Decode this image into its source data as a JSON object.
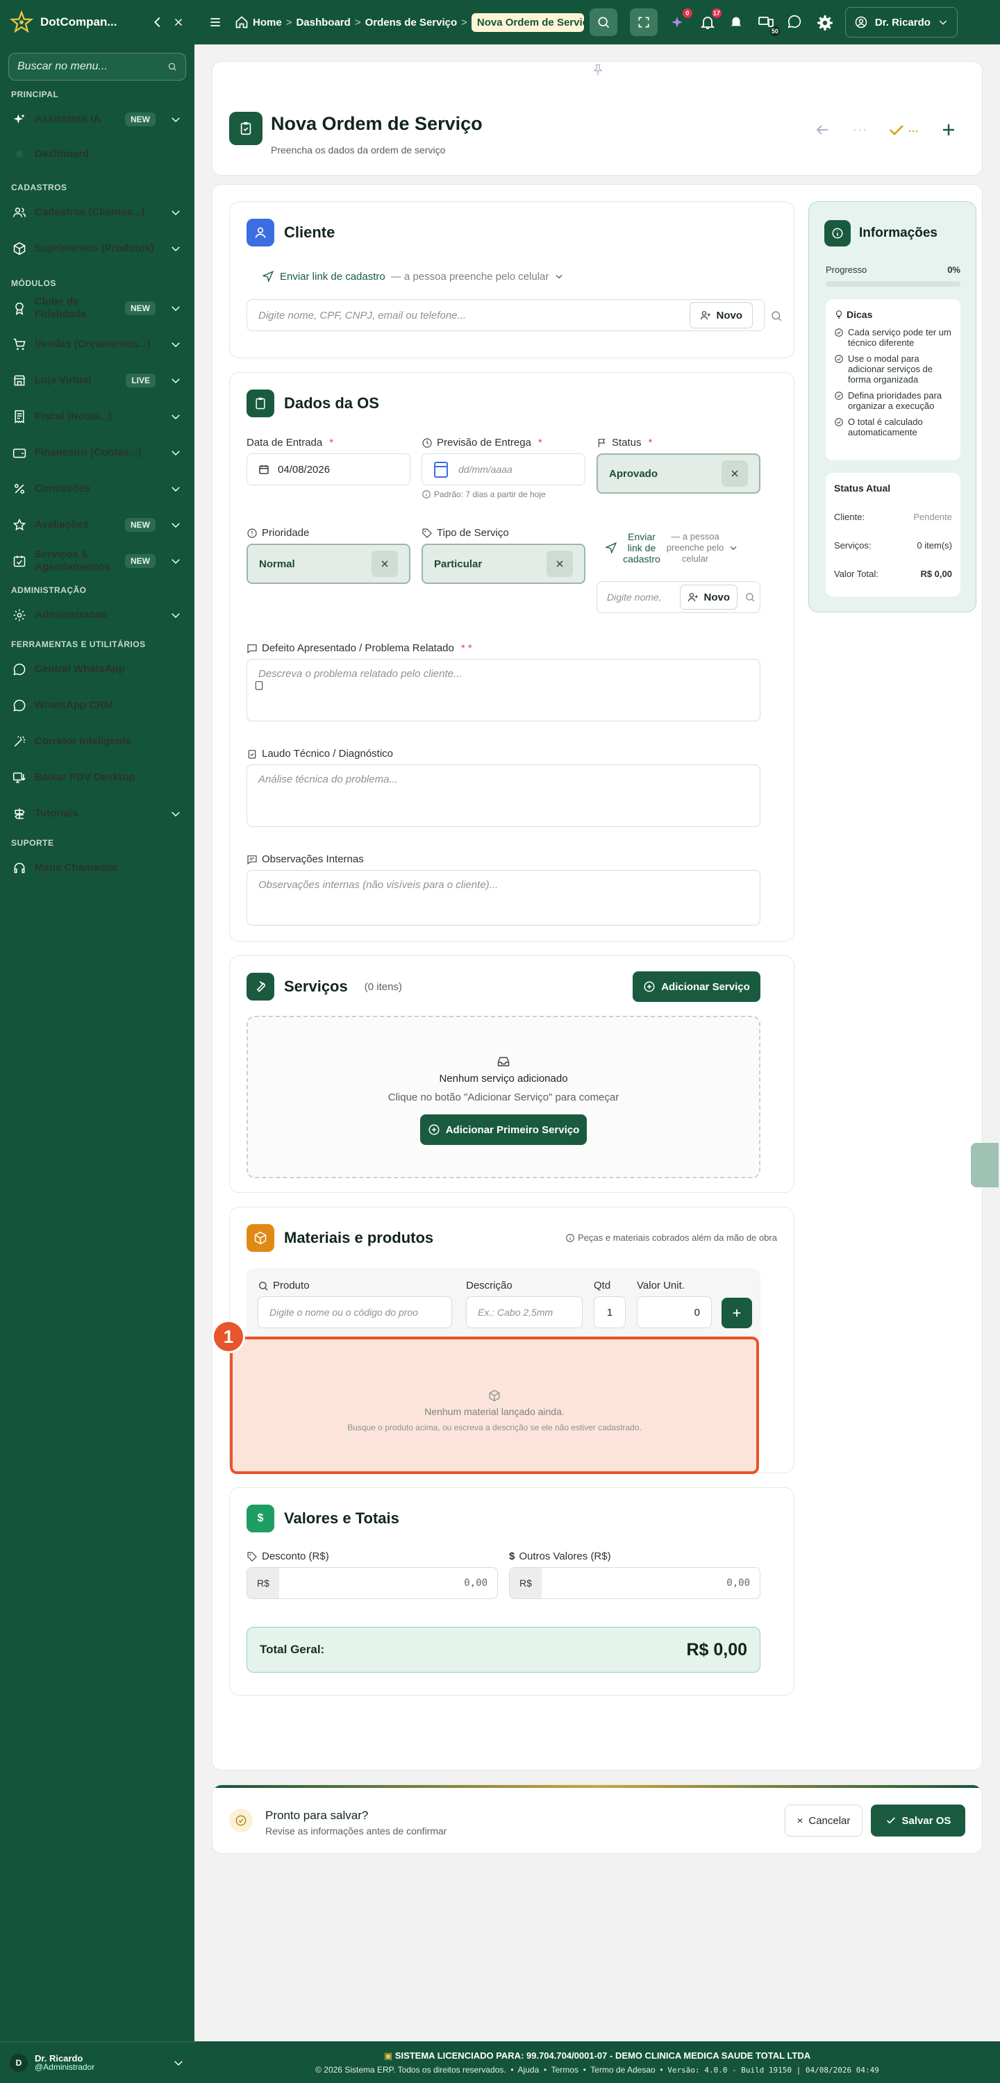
{
  "brand": {
    "name": "DotCompan..."
  },
  "sidebar": {
    "search_placeholder": "Buscar no menu...",
    "sections": {
      "principal": "PRINCIPAL",
      "cadastros": "CADASTROS",
      "modulos": "MÓDULOS",
      "administracao": "ADMINISTRAÇÃO",
      "ferramentas": "FERRAMENTAS E UTILITÁRIOS",
      "suporte": "SUPORTE"
    },
    "items": {
      "assistente": {
        "label": "Assistente IA",
        "badge": "NEW"
      },
      "dashboard": {
        "label": "Dashboard"
      },
      "cadastros": {
        "label": "Cadastros (Clientes...)"
      },
      "suprimentos": {
        "label": "Suprimentos (Produtos)"
      },
      "fidelidade": {
        "label": "Clube de Fidelidade",
        "badge": "NEW"
      },
      "vendas": {
        "label": "Vendas (Orçamentos...)"
      },
      "loja": {
        "label": "Loja Virtual",
        "badge": "LIVE"
      },
      "fiscal": {
        "label": "Fiscal (Notas...)"
      },
      "financeiro": {
        "label": "Financeiro (Contas...)"
      },
      "comissoes": {
        "label": "Comissões"
      },
      "avaliacoes": {
        "label": "Avaliações",
        "badge": "NEW"
      },
      "servicos": {
        "label": "Serviços & Agendamentos",
        "badge": "NEW"
      },
      "administracao": {
        "label": "Administracao"
      },
      "whatsapp_central": {
        "label": "Central WhatsApp"
      },
      "whatsapp_crm": {
        "label": "WhatsApp CRM"
      },
      "corretor": {
        "label": "Corretor Inteligente"
      },
      "pdv": {
        "label": "Baixar PDV Desktop"
      },
      "tutoriais": {
        "label": "Tutoriais"
      },
      "chamados": {
        "label": "Meus Chamados"
      }
    },
    "user": {
      "initial": "D",
      "name": "Dr. Ricardo",
      "role": "@Administrador"
    }
  },
  "topbar": {
    "breadcrumb": [
      "Home",
      "Dashboard",
      "Ordens de Serviço"
    ],
    "breadcrumb_current": "Nova Ordem de Serviço",
    "badge_ai": "0",
    "badge_notifications": "17",
    "badge_apps": "50",
    "user": "Dr. Ricardo"
  },
  "page": {
    "title": "Nova Ordem de Serviço",
    "subtitle": "Preencha os dados da ordem de serviço"
  },
  "cliente": {
    "title": "Cliente",
    "send_link": "Enviar link de cadastro",
    "send_hint": "— a pessoa preenche pelo celular",
    "search_placeholder": "Digite nome, CPF, CNPJ, email ou telefone...",
    "novo": "Novo"
  },
  "dados": {
    "title": "Dados da OS",
    "entrada_label": "Data de Entrada",
    "entrada_value": "04/08/2026",
    "previsao_label": "Previsão de Entrega",
    "previsao_placeholder": "dd/mm/aaaa",
    "previsao_hint": "Padrão: 7 dias a partir de hoje",
    "status_label": "Status",
    "status_value": "Aprovado",
    "prioridade_label": "Prioridade",
    "prioridade_value": "Normal",
    "tipo_label": "Tipo de Serviço",
    "tipo_value": "Particular",
    "send_link": "Enviar link de cadastro",
    "send_hint": "— a pessoa preenche pelo celular",
    "tec_placeholder": "Digite nome,",
    "novo": "Novo",
    "defeito_label": "Defeito Apresentado / Problema Relatado",
    "defeito_req": "* *",
    "defeito_placeholder": "Descreva o problema relatado pelo cliente...",
    "laudo_label": "Laudo Técnico / Diagnóstico",
    "laudo_placeholder": "Análise técnica do problema...",
    "obs_label": "Observações Internas",
    "obs_placeholder": "Observações internas (não visíveis para o cliente)..."
  },
  "servicos": {
    "title": "Serviços",
    "count": "(0 itens)",
    "add": "Adicionar Serviço",
    "empty_title": "Nenhum serviço adicionado",
    "empty_hint": "Clique no botão \"Adicionar Serviço\" para começar",
    "add_first": "Adicionar Primeiro Serviço"
  },
  "materiais": {
    "title": "Materiais e produtos",
    "hint": "Peças e materiais cobrados além da mão de obra",
    "produto_label": "Produto",
    "produto_placeholder": "Digite o nome ou o código do proo",
    "descricao_label": "Descrição",
    "descricao_placeholder": "Ex.: Cabo 2,5mm",
    "qtd_label": "Qtd",
    "qtd_value": "1",
    "valor_label": "Valor Unit.",
    "valor_value": "0",
    "empty_title": "Nenhum material lançado ainda.",
    "empty_hint": "Busque o produto acima, ou escreva a descrição se ele não estiver cadastrado.",
    "marker": "1"
  },
  "valores": {
    "title": "Valores e Totais",
    "desconto_label": "Desconto (R$)",
    "outros_label": "Outros Valores (R$)",
    "currency": "R$",
    "desconto_value": "0,00",
    "outros_value": "0,00",
    "total_label": "Total Geral:",
    "total_value": "R$ 0,00"
  },
  "info": {
    "title": "Informações",
    "progress_label": "Progresso",
    "progress_value": "0%",
    "progress_fraction": 0,
    "dicas_title": "Dicas",
    "tips": [
      "Cada serviço pode ter um técnico diferente",
      "Use o modal para adicionar serviços de forma organizada",
      "Defina prioridades para organizar a execução",
      "O total é calculado automaticamente"
    ],
    "status_title": "Status Atual",
    "cliente_label": "Cliente:",
    "cliente_value": "Pendente",
    "servicos_label": "Serviços:",
    "servicos_value": "0 item(s)",
    "valor_label": "Valor Total:",
    "valor_value": "R$ 0,00"
  },
  "save_bar": {
    "title": "Pronto para salvar?",
    "hint": "Revise as informações antes de confirmar",
    "cancel": "Cancelar",
    "save": "Salvar OS"
  },
  "footer": {
    "license": "SISTEMA LICENCIADO PARA: 99.704.704/0001-07 - DEMO CLINICA MEDICA SAUDE TOTAL LTDA",
    "copyright": "© 2026 Sistema ERP. Todos os direitos reservados.",
    "links": [
      "Ajuda",
      "Termos",
      "Termo de Adesao"
    ],
    "version": "Versão: 4.0.0 - Build 19150 | 04/08/2026 04:49"
  },
  "colors": {
    "brand": "#14543a",
    "accent": "#1a5b40",
    "highlight": "#e8542b",
    "gold": "#d4a017"
  }
}
